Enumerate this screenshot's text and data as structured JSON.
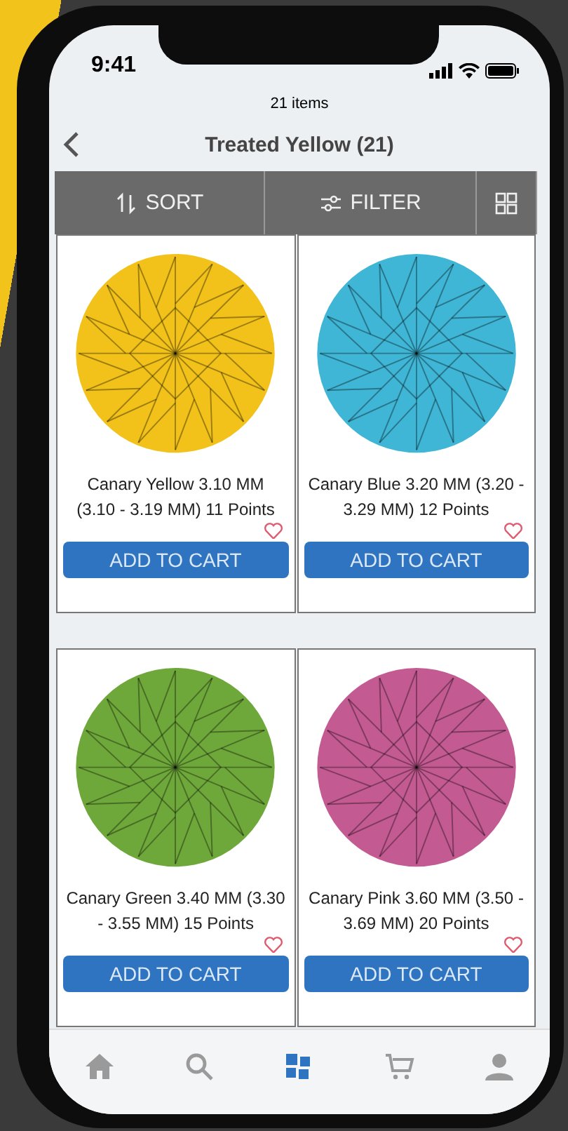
{
  "status_bar": {
    "time": "9:41"
  },
  "header": {
    "subtitle": "21 items",
    "title": "Treated Yellow (21)"
  },
  "toolbar": {
    "sort": "SORT",
    "filter": "FILTER"
  },
  "products": [
    {
      "name": "Canary Yellow 3.10 MM (3.10 - 3.19 MM) 11 Points",
      "color": "#f2c21b",
      "favorite": false,
      "button": "ADD TO CART"
    },
    {
      "name": "Canary Blue 3.20 MM (3.20 - 3.29 MM) 12 Points",
      "color": "#3fb6d6",
      "favorite": false,
      "button": "ADD TO CART"
    },
    {
      "name": "Canary Green 3.40 MM (3.30 - 3.55 MM) 15 Points",
      "color": "#6fa83a",
      "favorite": false,
      "button": "ADD TO CART"
    },
    {
      "name": "Canary Pink 3.60 MM (3.50 - 3.69 MM) 20 Points",
      "color": "#c45a92",
      "favorite": false,
      "button": "ADD TO CART"
    }
  ],
  "nav": [
    {
      "kind": "home",
      "selected": false
    },
    {
      "kind": "search",
      "selected": false
    },
    {
      "kind": "catalog",
      "selected": true
    },
    {
      "kind": "cart",
      "selected": false
    },
    {
      "kind": "account",
      "selected": false
    }
  ]
}
